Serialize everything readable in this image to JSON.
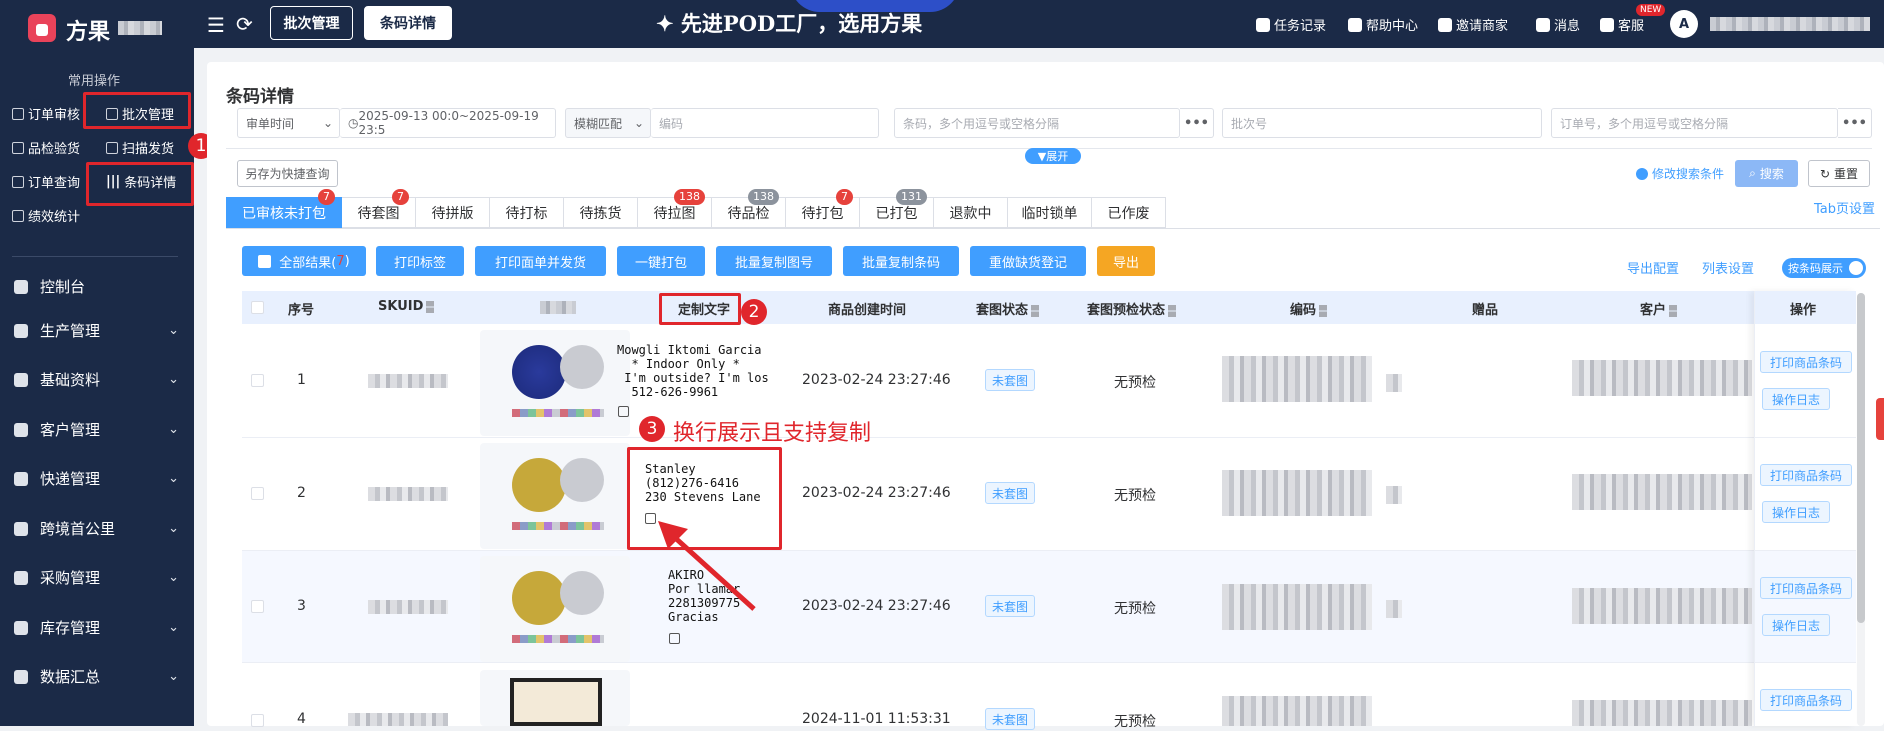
{
  "app": {
    "name": "方果"
  },
  "sidebar": {
    "section_title": "常用操作",
    "quick_ops": [
      "订单审核",
      "批次管理",
      "品检验货",
      "扫描发货",
      "订单查询",
      "条码详情",
      "绩效统计"
    ],
    "menu": [
      {
        "label": "控制台",
        "icon": "dashboard-icon"
      },
      {
        "label": "生产管理",
        "icon": "factory-icon"
      },
      {
        "label": "基础资料",
        "icon": "database-icon"
      },
      {
        "label": "客户管理",
        "icon": "user-icon"
      },
      {
        "label": "快递管理",
        "icon": "truck-icon"
      },
      {
        "label": "跨境首公里",
        "icon": "globe-icon"
      },
      {
        "label": "采购管理",
        "icon": "cart-icon"
      },
      {
        "label": "库存管理",
        "icon": "warehouse-icon"
      },
      {
        "label": "数据汇总",
        "icon": "pie-icon"
      }
    ]
  },
  "header": {
    "tabs": [
      "批次管理",
      "条码详情"
    ],
    "banner": "✦ 先进POD工厂，选用方果",
    "links": [
      "任务记录",
      "帮助中心",
      "邀请商家",
      "消息",
      "客服"
    ],
    "new_badge": "NEW",
    "avatar_letter": "A"
  },
  "page": {
    "title": "条码详情",
    "filters": {
      "time_type": "审单时间",
      "date_range": "2025-09-13 00:0~2025-09-19 23:5",
      "match_type": "模糊匹配",
      "code_placeholder": "编码",
      "barcode_placeholder": "条码，多个用逗号或空格分隔",
      "batch_placeholder": "批次号",
      "order_placeholder": "订单号，多个用逗号或空格分隔"
    },
    "expand_label": "▼展开",
    "save_quick": "另存为快捷查询",
    "modify_search": "修改搜索条件",
    "search": "搜索",
    "reset": "重置",
    "tab_settings": "Tab页设置"
  },
  "status_tabs": [
    {
      "label": "已审核未打包",
      "count": "7",
      "active": true
    },
    {
      "label": "待套图",
      "count": "7"
    },
    {
      "label": "待拼版",
      "count": ""
    },
    {
      "label": "待打标",
      "count": ""
    },
    {
      "label": "待拣货",
      "count": ""
    },
    {
      "label": "待拉图",
      "count": "138"
    },
    {
      "label": "待品检",
      "count": "138"
    },
    {
      "label": "待打包",
      "count": "7"
    },
    {
      "label": "已打包",
      "count": "131"
    },
    {
      "label": "退款中",
      "count": ""
    },
    {
      "label": "临时锁单",
      "count": ""
    },
    {
      "label": "已作废",
      "count": ""
    }
  ],
  "toolbar": {
    "all_results": "全部结果(",
    "all_results_count": "7",
    "all_results_end": ")",
    "buttons": [
      "打印标签",
      "打印面单并发货",
      "一键打包",
      "批量复制图号",
      "批量复制条码",
      "重做缺货登记",
      "导出"
    ],
    "export_config": "导出配置",
    "list_settings": "列表设置",
    "barcode_toggle": "按条码展示"
  },
  "table": {
    "columns": [
      "序号",
      "SKUID",
      "",
      "定制文字",
      "商品创建时间",
      "套图状态",
      "套图预检状态",
      "编码",
      "赠品",
      "客户",
      "操作"
    ],
    "rows": [
      {
        "no": "1",
        "custom_text": "Mowgli Iktomi Garcia\n  * Indoor Only *\n I'm outside? I'm los\n  512-626-9961",
        "created": "2023-02-24 23:27:46",
        "status": "未套图",
        "precheck": "无预检",
        "ball": "blue"
      },
      {
        "no": "2",
        "custom_text": "Stanley\n(812)276-6416\n230 Stevens Lane",
        "created": "2023-02-24 23:27:46",
        "status": "未套图",
        "precheck": "无预检",
        "ball": "gold"
      },
      {
        "no": "3",
        "custom_text": "AKIRO\nPor llamar\n2281309775\nGracias",
        "created": "2023-02-24 23:27:46",
        "status": "未套图",
        "precheck": "无预检",
        "ball": "gold"
      },
      {
        "no": "4",
        "custom_text": "",
        "created": "2024-11-01 11:53:31",
        "status": "未套图",
        "precheck": "无预检",
        "ball": "none"
      }
    ],
    "ops": [
      "打印商品条码",
      "操作日志"
    ]
  },
  "annotations": {
    "n1": "1",
    "n2": "2",
    "n3": "3",
    "text3": "换行展示且支持复制"
  },
  "colors": {
    "nav": "#1b2a47",
    "primary": "#409eff",
    "danger": "#e0262c",
    "orange": "#f5a623"
  }
}
